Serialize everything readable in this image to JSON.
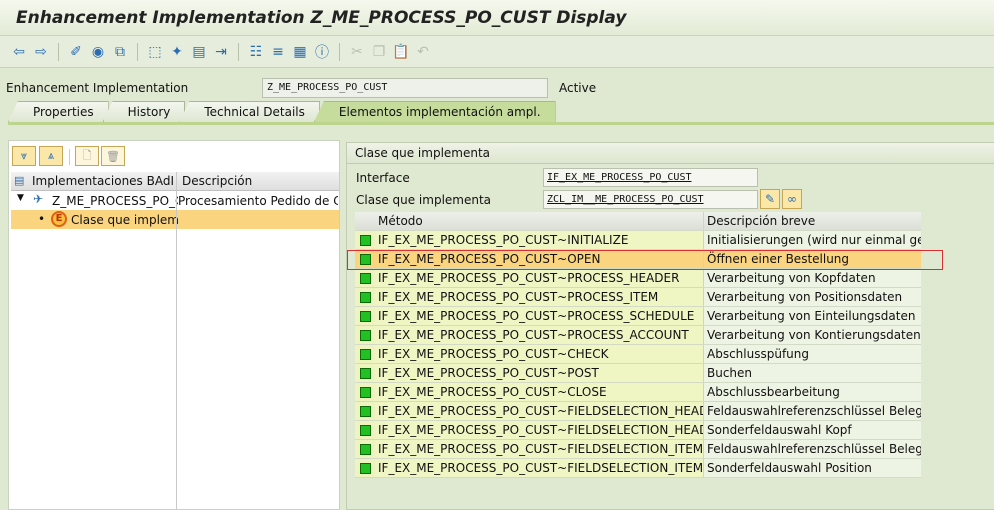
{
  "window": {
    "title": "Enhancement Implementation Z_ME_PROCESS_PO_CUST Display"
  },
  "toolbar": {
    "icons": [
      "back-icon",
      "forward-icon",
      "display-change-icon",
      "activate-icon",
      "copy-object-icon",
      "check-icon",
      "magic-wand-icon",
      "print-icon",
      "export-icon",
      "hierarchy-icon",
      "align-icon",
      "list-icon",
      "info-icon",
      "cut-icon",
      "copy-icon",
      "paste-icon",
      "undo-icon"
    ]
  },
  "header": {
    "label": "Enhancement Implementation",
    "value": "Z_ME_PROCESS_PO_CUST",
    "status": "Active"
  },
  "tabs": [
    {
      "label": "Properties"
    },
    {
      "label": "History"
    },
    {
      "label": "Technical Details"
    },
    {
      "label": "Elementos implementación ampl.",
      "active": true
    }
  ],
  "tree": {
    "columns": [
      "Implementaciones BAdI",
      "Descripción"
    ],
    "rows": [
      {
        "name": "Z_ME_PROCESS_PO_C",
        "desc": "Procesamiento Pedido de Cor"
      },
      {
        "name": "Clase que implemer",
        "desc": "",
        "selected": true
      }
    ]
  },
  "detail": {
    "title": "Clase que implementa",
    "interface_label": "Interface",
    "interface_value": "IF_EX_ME_PROCESS_PO_CUST",
    "class_label": "Clase que implementa",
    "class_value": "ZCL_IM__ME_PROCESS_PO_CUST",
    "columns": [
      "Método",
      "Descripción breve"
    ],
    "methods": [
      {
        "method": "IF_EX_ME_PROCESS_PO_CUST~INITIALIZE",
        "desc": "Initialisierungen (wird nur einmal geru..."
      },
      {
        "method": "IF_EX_ME_PROCESS_PO_CUST~OPEN",
        "desc": "Öffnen einer Bestellung",
        "selected": true
      },
      {
        "method": "IF_EX_ME_PROCESS_PO_CUST~PROCESS_HEADER",
        "desc": "Verarbeitung von Kopfdaten"
      },
      {
        "method": "IF_EX_ME_PROCESS_PO_CUST~PROCESS_ITEM",
        "desc": "Verarbeitung von Positionsdaten"
      },
      {
        "method": "IF_EX_ME_PROCESS_PO_CUST~PROCESS_SCHEDULE",
        "desc": "Verarbeitung von Einteilungsdaten"
      },
      {
        "method": "IF_EX_ME_PROCESS_PO_CUST~PROCESS_ACCOUNT",
        "desc": "Verarbeitung von Kontierungsdaten"
      },
      {
        "method": "IF_EX_ME_PROCESS_PO_CUST~CHECK",
        "desc": "Abschlusspüfung"
      },
      {
        "method": "IF_EX_ME_PROCESS_PO_CUST~POST",
        "desc": "Buchen"
      },
      {
        "method": "IF_EX_ME_PROCESS_PO_CUST~CLOSE",
        "desc": "Abschlussbearbeitung"
      },
      {
        "method": "IF_EX_ME_PROCESS_PO_CUST~FIELDSELECTION_HEAD...",
        "desc": "Feldauswahlreferenzschlüssel Belegko..."
      },
      {
        "method": "IF_EX_ME_PROCESS_PO_CUST~FIELDSELECTION_HEAD...",
        "desc": "Sonderfeldauswahl Kopf"
      },
      {
        "method": "IF_EX_ME_PROCESS_PO_CUST~FIELDSELECTION_ITEM_...",
        "desc": "Feldauswahlreferenzschlüssel Belegpo..."
      },
      {
        "method": "IF_EX_ME_PROCESS_PO_CUST~FIELDSELECTION_ITEM",
        "desc": "Sonderfeldauswahl Position"
      }
    ]
  },
  "colors": {
    "status_active": "#22c022",
    "selection": "#fbd480",
    "highlight_border": "#d83030"
  }
}
